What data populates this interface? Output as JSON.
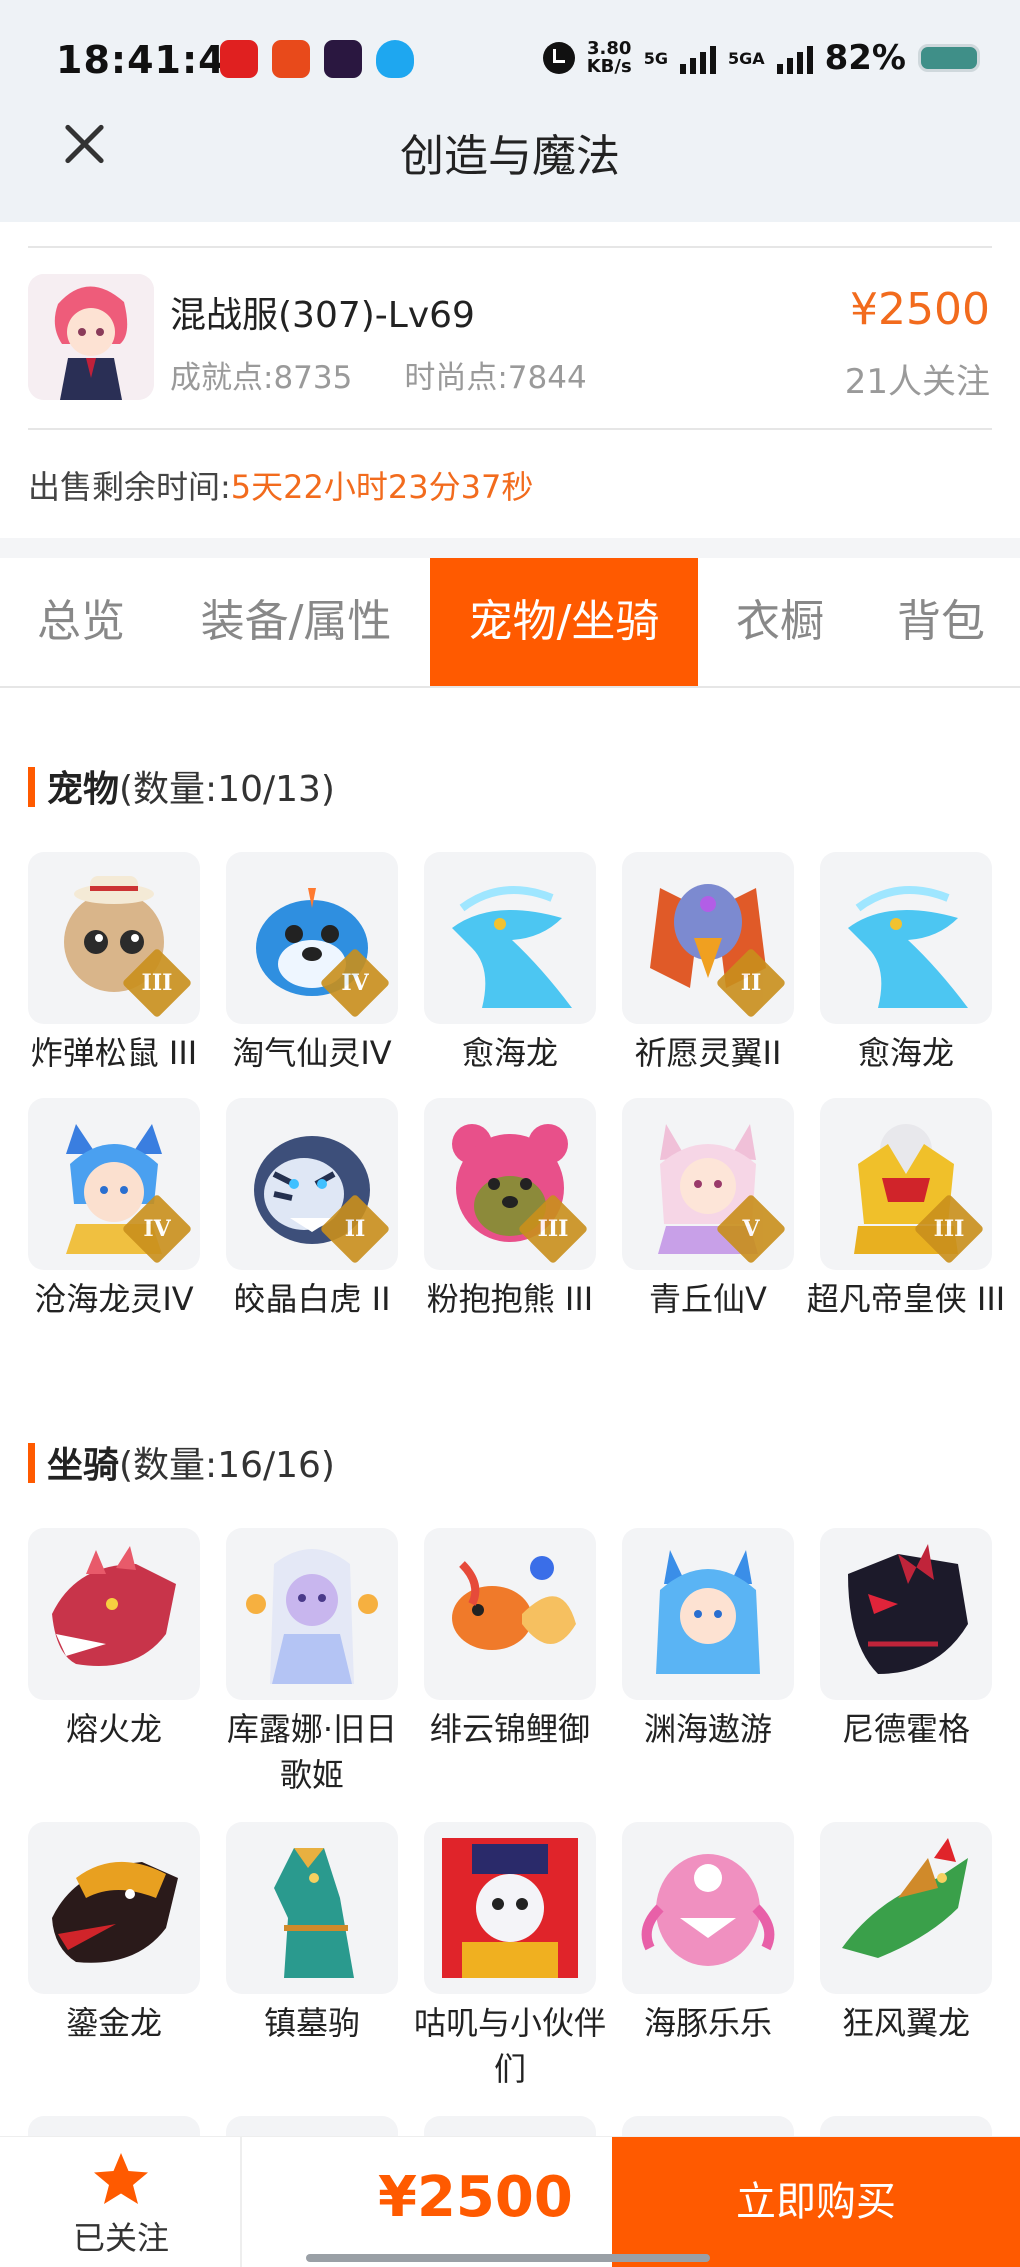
{
  "status_bar": {
    "time": "18:41:49",
    "net_speed_value": "3.80",
    "net_speed_unit": "KB/s",
    "network_1": "5G",
    "network_2": "5GA",
    "battery": "82%"
  },
  "header": {
    "title": "创造与魔法"
  },
  "product": {
    "server_level": "混战服(307)-Lv69",
    "achievement": "成就点:8735",
    "fashion": "时尚点:7844",
    "price": "¥2500",
    "followers": "21人关注",
    "remaining_label": "出售剩余时间:",
    "remaining_value": "5天22小时23分37秒"
  },
  "tabs": [
    {
      "label": "总览"
    },
    {
      "label": "装备/属性"
    },
    {
      "label": "宠物/坐骑",
      "active": true
    },
    {
      "label": "衣橱"
    },
    {
      "label": "背包"
    }
  ],
  "pets": {
    "title": "宠物",
    "count": "(数量:10/13)",
    "items": [
      {
        "name": "炸弹松鼠 III",
        "icon": "squirrel-pet-icon",
        "badge": "III"
      },
      {
        "name": "淘气仙灵IV",
        "icon": "blue-dog-pet-icon",
        "badge": "IV"
      },
      {
        "name": "愈海龙",
        "icon": "sea-dragon-pet-icon",
        "badge": ""
      },
      {
        "name": "祈愿灵翼II",
        "icon": "griffin-pet-icon",
        "badge": "II"
      },
      {
        "name": "愈海龙",
        "icon": "sea-dragon-pet-icon",
        "badge": ""
      },
      {
        "name": "沧海龙灵IV",
        "icon": "dragon-spirit-pet-icon",
        "badge": "IV"
      },
      {
        "name": "皎晶白虎 II",
        "icon": "white-tiger-pet-icon",
        "badge": "II"
      },
      {
        "name": "粉抱抱熊 III",
        "icon": "pink-bear-pet-icon",
        "badge": "III"
      },
      {
        "name": "青丘仙V",
        "icon": "fox-fairy-pet-icon",
        "badge": "V"
      },
      {
        "name": "超凡帝皇侠 III",
        "icon": "golden-knight-pet-icon",
        "badge": "III"
      }
    ]
  },
  "mounts": {
    "title": "坐骑",
    "count": "(数量:16/16)",
    "items": [
      {
        "name": "熔火龙",
        "icon": "fire-dragon-mount-icon"
      },
      {
        "name": "库露娜·旧日歌姬",
        "icon": "singer-mount-icon"
      },
      {
        "name": "绯云锦鲤御",
        "icon": "koi-mount-icon"
      },
      {
        "name": "渊海遨游",
        "icon": "sea-rider-mount-icon"
      },
      {
        "name": "尼德霍格",
        "icon": "black-dragon-mount-icon"
      },
      {
        "name": "鎏金龙",
        "icon": "gold-dragon-mount-icon"
      },
      {
        "name": "镇墓驹",
        "icon": "jade-horse-mount-icon"
      },
      {
        "name": "咕叽与小伙伴们",
        "icon": "parade-mount-icon"
      },
      {
        "name": "海豚乐乐",
        "icon": "dolphin-mount-icon"
      },
      {
        "name": "狂风翼龙",
        "icon": "wind-wyvern-mount-icon"
      }
    ]
  },
  "bottom_bar": {
    "follow_label": "已关注",
    "price": "¥2500",
    "buy_label": "立即购买"
  },
  "colors": {
    "accent": "#ff5a00",
    "price": "#f26b1d",
    "muted": "#9a9a9a"
  }
}
